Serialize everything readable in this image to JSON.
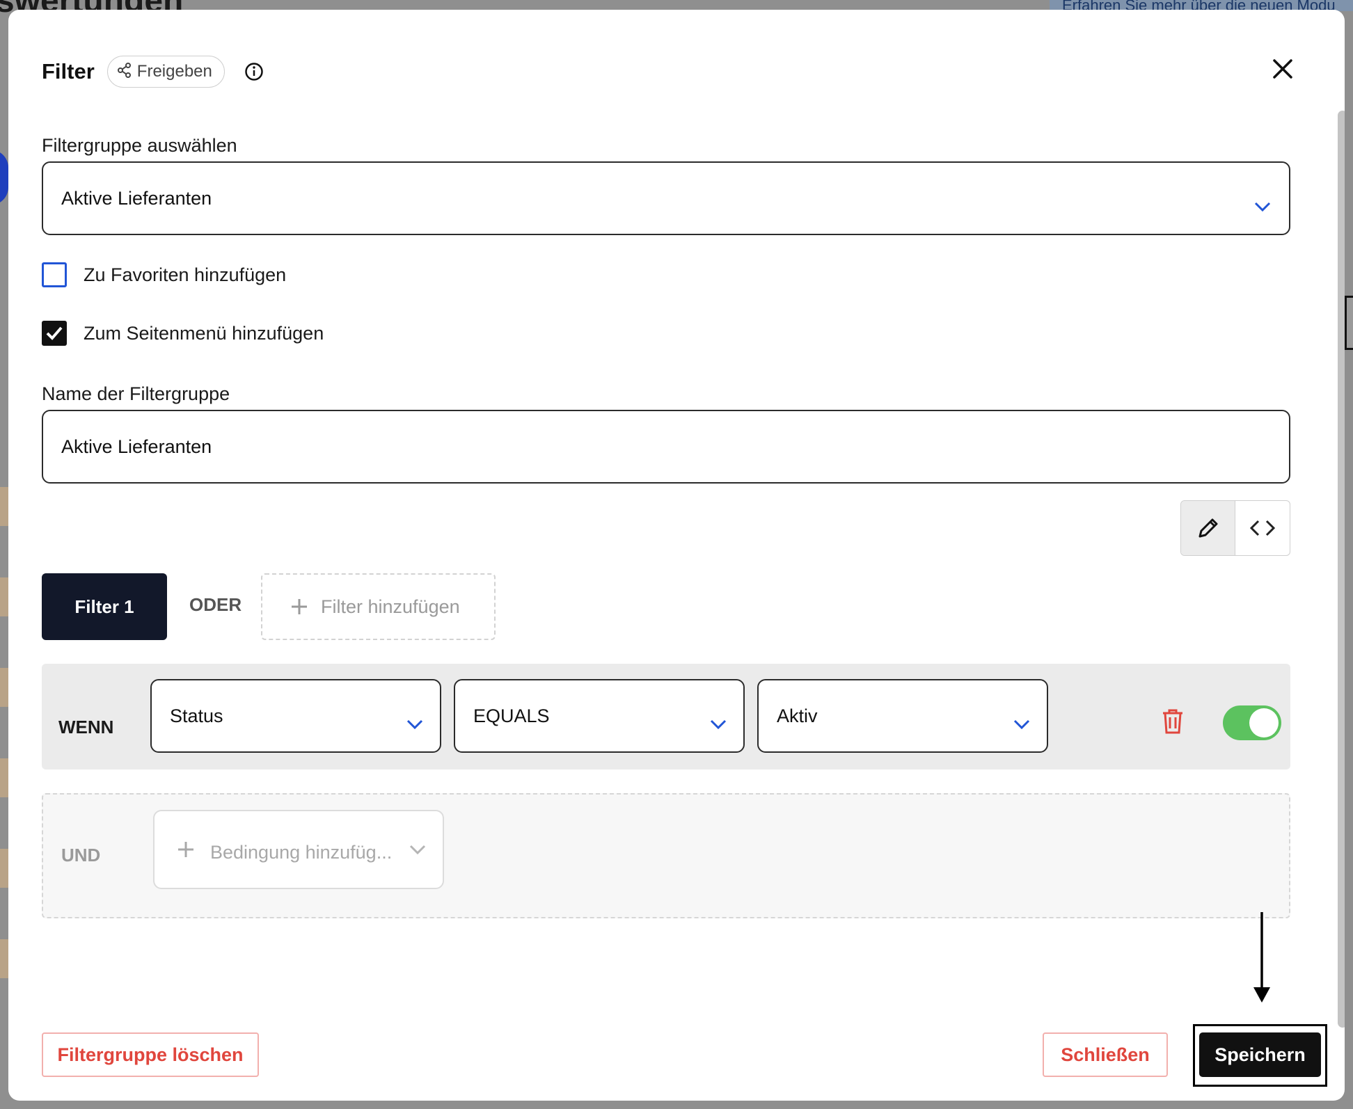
{
  "backdrop": {
    "heading_fragment": "swertungen",
    "banner_fragment": "Erfahren Sie mehr über die neuen Modu"
  },
  "modal": {
    "title": "Filter",
    "share_label": "Freigeben",
    "icons": {
      "share": "share-icon",
      "info": "info-icon",
      "close": "close-icon"
    }
  },
  "filtergroup_select": {
    "label": "Filtergruppe auswählen",
    "value": "Aktive Lieferanten"
  },
  "options": {
    "favorites_label": "Zu Favoriten hinzufügen",
    "favorites_checked": false,
    "sidemenu_label": "Zum Seitenmenü hinzufügen",
    "sidemenu_checked": true
  },
  "name_field": {
    "label": "Name der Filtergruppe",
    "value": "Aktive Lieferanten"
  },
  "mode_toggle": {
    "active": "edit",
    "icons": [
      "pencil-icon",
      "code-icon"
    ]
  },
  "filter_tabs": {
    "tabs": [
      {
        "label": "Filter 1",
        "active": true
      }
    ],
    "separator": "ODER",
    "add_label": "Filter hinzufügen"
  },
  "condition": {
    "keyword": "WENN",
    "field": "Status",
    "operator": "EQUALS",
    "value": "Aktiv",
    "enabled": true
  },
  "and_group": {
    "keyword": "UND",
    "add_placeholder": "Bedingung hinzufüg..."
  },
  "footer": {
    "delete_label": "Filtergruppe löschen",
    "close_label": "Schließen",
    "save_label": "Speichern"
  },
  "colors": {
    "accent_blue": "#2155d6",
    "danger_red": "#e0463d",
    "toggle_green": "#5cc25f",
    "dark_tab": "#12182a"
  }
}
